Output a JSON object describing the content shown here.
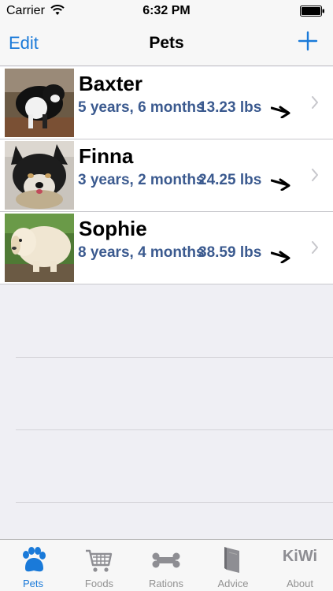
{
  "status_bar": {
    "carrier": "Carrier",
    "time": "6:32 PM"
  },
  "nav": {
    "edit_label": "Edit",
    "title": "Pets",
    "add_icon": "plus-icon"
  },
  "colors": {
    "accent": "#1a7ad9",
    "detail_text": "#3b5a8f",
    "inactive": "#929292",
    "background": "#efeff4"
  },
  "pets": [
    {
      "name": "Baxter",
      "age": "5 years, 6 months",
      "weight": "13.23 lbs",
      "trend": "down"
    },
    {
      "name": "Finna",
      "age": "3 years, 2 months",
      "weight": "24.25 lbs",
      "trend": "down"
    },
    {
      "name": "Sophie",
      "age": "8 years, 4 months",
      "weight": "38.59 lbs",
      "trend": "down"
    }
  ],
  "tabs": [
    {
      "label": "Pets",
      "icon": "paw-icon",
      "active": true
    },
    {
      "label": "Foods",
      "icon": "cart-icon",
      "active": false
    },
    {
      "label": "Rations",
      "icon": "bone-icon",
      "active": false
    },
    {
      "label": "Advice",
      "icon": "book-icon",
      "active": false
    },
    {
      "label": "About",
      "icon_text": "KiWi",
      "active": false
    }
  ]
}
